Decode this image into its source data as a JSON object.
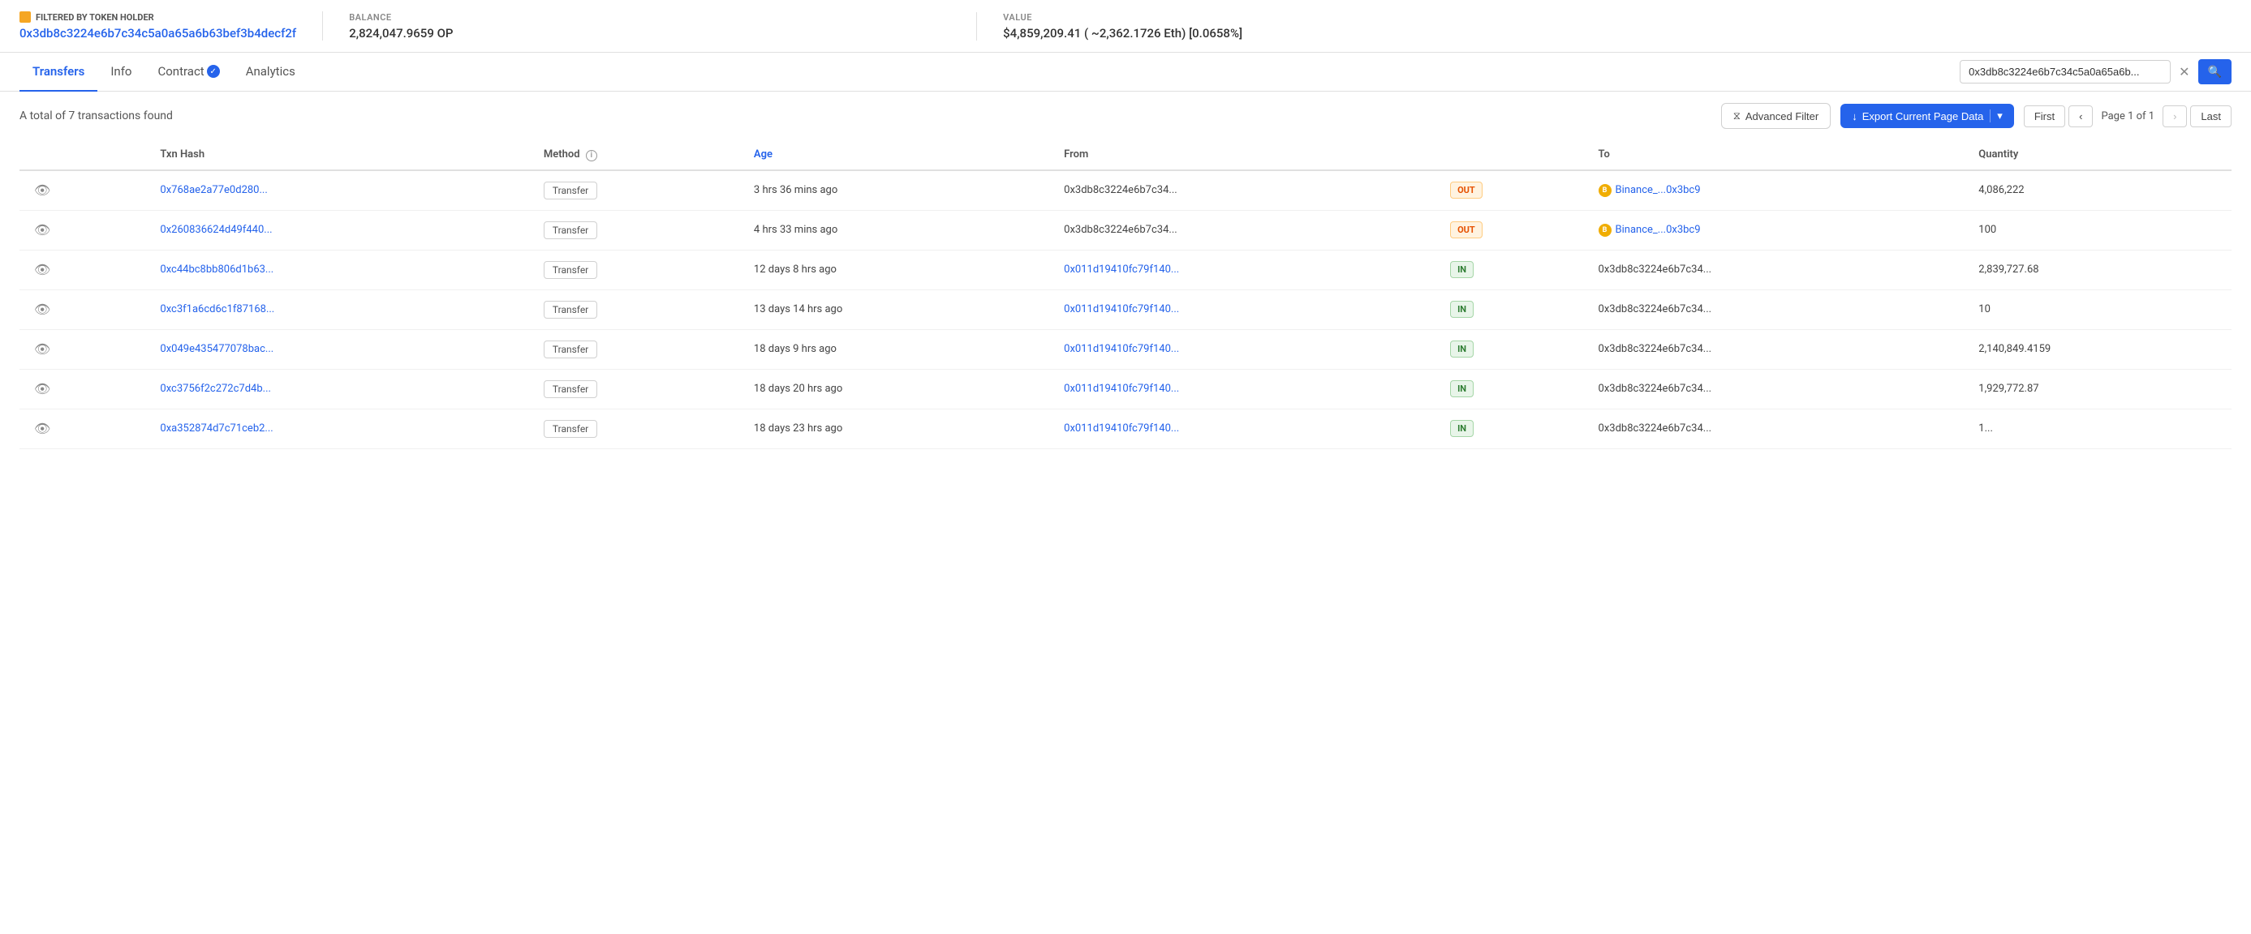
{
  "banner": {
    "token_holder_label": "FILTERED BY TOKEN HOLDER",
    "address": "0x3db8c3224e6b7c34c5a0a65a6b63bef3b4decf2f",
    "balance_label": "BALANCE",
    "balance_value": "2,824,047.9659 OP",
    "value_label": "VALUE",
    "value_value": "$4,859,209.41 ( ~2,362.1726 Eth) [0.0658%]"
  },
  "tabs": [
    {
      "id": "transfers",
      "label": "Transfers",
      "active": true
    },
    {
      "id": "info",
      "label": "Info",
      "active": false
    },
    {
      "id": "contract",
      "label": "Contract",
      "active": false,
      "verified": true
    },
    {
      "id": "analytics",
      "label": "Analytics",
      "active": false
    }
  ],
  "search": {
    "placeholder": "0x3db8c3224e6b7c34c5a0a65a6b...",
    "value": "0x3db8c3224e6b7c34c5a0a65a6b..."
  },
  "toolbar": {
    "total_text": "A total of 7 transactions found",
    "filter_label": "Advanced Filter",
    "export_label": "Export Current Page Data",
    "pagination": {
      "first": "First",
      "last": "Last",
      "page_info": "Page 1 of 1"
    }
  },
  "table": {
    "headers": [
      "",
      "Txn Hash",
      "Method",
      "Age",
      "From",
      "",
      "To",
      "Quantity"
    ],
    "rows": [
      {
        "txn_hash": "0x768ae2a77e0d280...",
        "method": "Transfer",
        "age": "3 hrs 36 mins ago",
        "from": "0x3db8c3224e6b7c34...",
        "from_type": "normal",
        "direction": "OUT",
        "to": "Binance_...0x3bc9",
        "to_type": "binance",
        "quantity": "4,086,222"
      },
      {
        "txn_hash": "0x260836624d49f440...",
        "method": "Transfer",
        "age": "4 hrs 33 mins ago",
        "from": "0x3db8c3224e6b7c34...",
        "from_type": "normal",
        "direction": "OUT",
        "to": "Binance_...0x3bc9",
        "to_type": "binance",
        "quantity": "100"
      },
      {
        "txn_hash": "0xc44bc8bb806d1b63...",
        "method": "Transfer",
        "age": "12 days 8 hrs ago",
        "from": "0x011d19410fc79f140...",
        "from_type": "link",
        "direction": "IN",
        "to": "0x3db8c3224e6b7c34...",
        "to_type": "normal",
        "quantity": "2,839,727.68"
      },
      {
        "txn_hash": "0xc3f1a6cd6c1f87168...",
        "method": "Transfer",
        "age": "13 days 14 hrs ago",
        "from": "0x011d19410fc79f140...",
        "from_type": "link",
        "direction": "IN",
        "to": "0x3db8c3224e6b7c34...",
        "to_type": "normal",
        "quantity": "10"
      },
      {
        "txn_hash": "0x049e435477078bac...",
        "method": "Transfer",
        "age": "18 days 9 hrs ago",
        "from": "0x011d19410fc79f140...",
        "from_type": "link",
        "direction": "IN",
        "to": "0x3db8c3224e6b7c34...",
        "to_type": "normal",
        "quantity": "2,140,849.4159"
      },
      {
        "txn_hash": "0xc3756f2c272c7d4b...",
        "method": "Transfer",
        "age": "18 days 20 hrs ago",
        "from": "0x011d19410fc79f140...",
        "from_type": "link",
        "direction": "IN",
        "to": "0x3db8c3224e6b7c34...",
        "to_type": "normal",
        "quantity": "1,929,772.87"
      },
      {
        "txn_hash": "0xa352874d7c71ceb2...",
        "method": "Transfer",
        "age": "18 days 23 hrs ago",
        "from": "0x011d19410fc79f140...",
        "from_type": "link",
        "direction": "IN",
        "to": "0x3db8c3224e6b7c34...",
        "to_type": "normal",
        "quantity": "1..."
      }
    ]
  },
  "icons": {
    "eye": "👁",
    "filter": "⧖",
    "download": "↓",
    "search": "🔍",
    "chevron_left": "‹",
    "chevron_right": "›"
  }
}
